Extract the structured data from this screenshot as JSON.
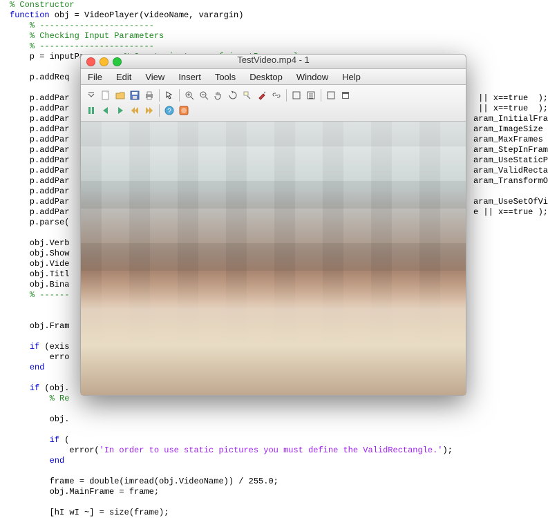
{
  "code_lines": [
    {
      "t": "% Constructor",
      "cls": "c",
      "i": 0
    },
    {
      "t": "function obj = VideoPlayer(videoName, varargin)",
      "cls": "plain",
      "i": 0,
      "kw": "function"
    },
    {
      "t": "% -----------------------",
      "cls": "c",
      "i": 1
    },
    {
      "t": "% Checking Input Parameters",
      "cls": "c",
      "i": 1
    },
    {
      "t": "% -----------------------",
      "cls": "c",
      "i": 1
    },
    {
      "t": "p = inputParser;   % Create instance of inputParser class.",
      "cls": "plain",
      "i": 1,
      "cm": "% Create instance of inputParser class."
    },
    {
      "t": "",
      "cls": "plain",
      "i": 1
    },
    {
      "t": "p.addReq",
      "cls": "plain",
      "i": 1
    },
    {
      "t": "",
      "cls": "plain",
      "i": 1
    },
    {
      "t": "p.addPar",
      "cls": "plain",
      "i": 1,
      "tail": "|| x==true  );"
    },
    {
      "t": "p.addPar",
      "cls": "plain",
      "i": 1,
      "tail": "|| x==true  );"
    },
    {
      "t": "p.addPar",
      "cls": "plain",
      "i": 1,
      "tail": "aram_InitialFra"
    },
    {
      "t": "p.addPar",
      "cls": "plain",
      "i": 1,
      "tail": "aram_ImageSize "
    },
    {
      "t": "p.addPar",
      "cls": "plain",
      "i": 1,
      "tail": "aram_MaxFrames "
    },
    {
      "t": "p.addPar",
      "cls": "plain",
      "i": 1,
      "tail": "aram_StepInFram"
    },
    {
      "t": "p.addPar",
      "cls": "plain",
      "i": 1,
      "tail": "aram_UseStaticP"
    },
    {
      "t": "p.addPar",
      "cls": "plain",
      "i": 1,
      "tail": "aram_ValidRecta"
    },
    {
      "t": "p.addPar",
      "cls": "plain",
      "i": 1,
      "tail": "aram_TransformO"
    },
    {
      "t": "p.addPar",
      "cls": "plain",
      "i": 1
    },
    {
      "t": "p.addPar",
      "cls": "plain",
      "i": 1,
      "tail": "aram_UseSetOfVi"
    },
    {
      "t": "p.addPar",
      "cls": "plain",
      "i": 1,
      "tail": "e || x==true );"
    },
    {
      "t": "p.parse(",
      "cls": "plain",
      "i": 1
    },
    {
      "t": "",
      "cls": "plain",
      "i": 1
    },
    {
      "t": "obj.Verb",
      "cls": "plain",
      "i": 1
    },
    {
      "t": "obj.Show",
      "cls": "plain",
      "i": 1
    },
    {
      "t": "obj.Vide",
      "cls": "plain",
      "i": 1
    },
    {
      "t": "obj.Titl",
      "cls": "plain",
      "i": 1
    },
    {
      "t": "obj.Bina",
      "cls": "plain",
      "i": 1
    },
    {
      "t": "% ------",
      "cls": "c",
      "i": 1
    },
    {
      "t": "",
      "cls": "plain",
      "i": 1
    },
    {
      "t": "",
      "cls": "plain",
      "i": 1
    },
    {
      "t": "obj.Fram",
      "cls": "plain",
      "i": 1
    },
    {
      "t": "",
      "cls": "plain",
      "i": 1
    },
    {
      "t": "if (exis",
      "cls": "plain",
      "i": 1,
      "kw": "if"
    },
    {
      "t": "erro",
      "cls": "plain",
      "i": 2
    },
    {
      "t": "end",
      "cls": "k",
      "i": 1
    },
    {
      "t": "",
      "cls": "plain",
      "i": 1
    },
    {
      "t": "if (obj.",
      "cls": "plain",
      "i": 1,
      "kw": "if"
    },
    {
      "t": "% Re",
      "cls": "c",
      "i": 2
    },
    {
      "t": "",
      "cls": "plain",
      "i": 2
    },
    {
      "t": "obj.",
      "cls": "plain",
      "i": 2
    },
    {
      "t": "",
      "cls": "plain",
      "i": 2
    },
    {
      "t": "if (",
      "cls": "plain",
      "i": 2,
      "kw": "if"
    },
    {
      "t": "error('In order to use static pictures you must define the ValidRectangle.');",
      "cls": "plain",
      "i": 3,
      "str": "'In order to use static pictures you must define the ValidRectangle.'"
    },
    {
      "t": "end",
      "cls": "k",
      "i": 2
    },
    {
      "t": "",
      "cls": "plain",
      "i": 2
    },
    {
      "t": "frame = double(imread(obj.VideoName)) / 255.0;",
      "cls": "plain",
      "i": 2
    },
    {
      "t": "obj.MainFrame = frame;",
      "cls": "plain",
      "i": 2
    },
    {
      "t": "",
      "cls": "plain",
      "i": 2
    },
    {
      "t": "[hI wI ~] = size(frame);",
      "cls": "plain",
      "i": 2
    }
  ],
  "window": {
    "title": "TestVideo.mp4 - 1",
    "traffic": {
      "close": "#ff5f56",
      "min": "#ffbd2e",
      "max": "#27c93f"
    },
    "menus": [
      "File",
      "Edit",
      "View",
      "Insert",
      "Tools",
      "Desktop",
      "Window",
      "Help"
    ],
    "tb_row1": [
      {
        "name": "dropdown-icon",
        "svg": "dd"
      },
      {
        "name": "new-icon",
        "svg": "new"
      },
      {
        "name": "open-icon",
        "svg": "open"
      },
      {
        "name": "save-icon",
        "svg": "save"
      },
      {
        "name": "print-icon",
        "svg": "print"
      },
      {
        "name": "sep"
      },
      {
        "name": "arrow-icon",
        "svg": "arrow"
      },
      {
        "name": "sep"
      },
      {
        "name": "zoom-in-icon",
        "svg": "zin"
      },
      {
        "name": "zoom-out-icon",
        "svg": "zout"
      },
      {
        "name": "pan-icon",
        "svg": "hand"
      },
      {
        "name": "rotate-icon",
        "svg": "rot"
      },
      {
        "name": "data-cursor-icon",
        "svg": "dc"
      },
      {
        "name": "brush-icon",
        "svg": "brush"
      },
      {
        "name": "link-icon",
        "svg": "link"
      },
      {
        "name": "sep"
      },
      {
        "name": "colorbar-icon",
        "svg": "cb"
      },
      {
        "name": "legend-icon",
        "svg": "leg"
      },
      {
        "name": "sep"
      },
      {
        "name": "expand-icon",
        "svg": "exp"
      },
      {
        "name": "dock-icon",
        "svg": "dock"
      }
    ],
    "tb_row2": [
      {
        "name": "pause-icon",
        "svg": "pause"
      },
      {
        "name": "back-icon",
        "svg": "back"
      },
      {
        "name": "play-icon",
        "svg": "play"
      },
      {
        "name": "rewind-icon",
        "svg": "rw"
      },
      {
        "name": "forward-icon",
        "svg": "ff"
      },
      {
        "name": "sep"
      },
      {
        "name": "help-icon",
        "svg": "help"
      },
      {
        "name": "stop-icon",
        "svg": "stop"
      }
    ]
  }
}
